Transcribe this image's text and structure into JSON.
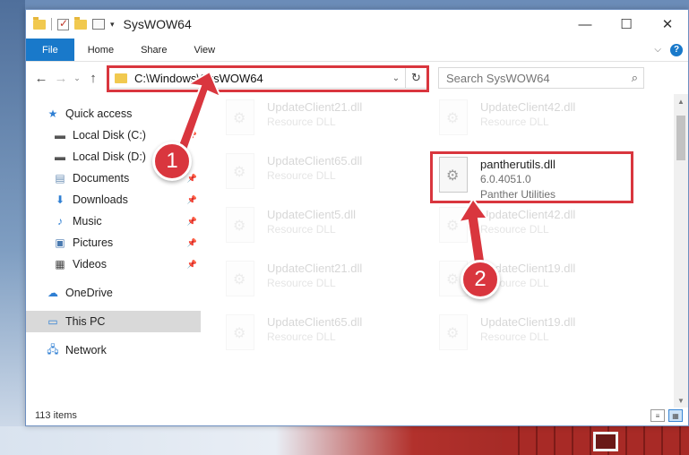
{
  "window": {
    "title": "SysWOW64",
    "controls": {
      "minimize": "—",
      "maximize": "☐",
      "close": "✕"
    }
  },
  "ribbon": {
    "tabs": [
      {
        "label": "File"
      },
      {
        "label": "Share"
      },
      {
        "label": "View"
      }
    ],
    "home": "Home"
  },
  "address": {
    "path": "C:\\Windows\\SysWOW64",
    "search_placeholder": "Search SysWOW64"
  },
  "nav": {
    "quick_access": "Quick access",
    "items": [
      {
        "label": "Local Disk (C:)",
        "icon": "drive-icon",
        "pinned": true
      },
      {
        "label": "Local Disk (D:)",
        "icon": "drive-icon",
        "pinned": false
      },
      {
        "label": "Documents",
        "icon": "documents-icon",
        "pinned": true
      },
      {
        "label": "Downloads",
        "icon": "downloads-icon",
        "pinned": true
      },
      {
        "label": "Music",
        "icon": "music-icon",
        "pinned": true
      },
      {
        "label": "Pictures",
        "icon": "pictures-icon",
        "pinned": true
      },
      {
        "label": "Videos",
        "icon": "videos-icon",
        "pinned": true
      }
    ],
    "onedrive": "OneDrive",
    "this_pc": "This PC",
    "network": "Network"
  },
  "files": [
    {
      "name": "UpdateClient21.dll",
      "desc": "Resource DLL"
    },
    {
      "name": "UpdateClient42.dll",
      "desc": "Resource DLL"
    },
    {
      "name": "UpdateClient65.dll",
      "desc": "Resource DLL"
    },
    {
      "name": "pantherutils.dll",
      "desc": "6.0.4051.0",
      "desc2": "Panther Utilities"
    },
    {
      "name": "UpdateClient5.dll",
      "desc": "Resource DLL"
    },
    {
      "name": "UpdateClient42.dll",
      "desc": "Resource DLL"
    },
    {
      "name": "UpdateClient21.dll",
      "desc": "Resource DLL"
    },
    {
      "name": "UpdateClient19.dll",
      "desc": "Resource DLL"
    },
    {
      "name": "UpdateClient65.dll",
      "desc": "Resource DLL"
    },
    {
      "name": "UpdateClient19.dll",
      "desc": "Resource DLL"
    }
  ],
  "status": {
    "count": "113 items"
  },
  "annotations": {
    "step1": "1",
    "step2": "2"
  },
  "colors": {
    "accent": "#1979ca",
    "highlight": "#d9363e"
  }
}
